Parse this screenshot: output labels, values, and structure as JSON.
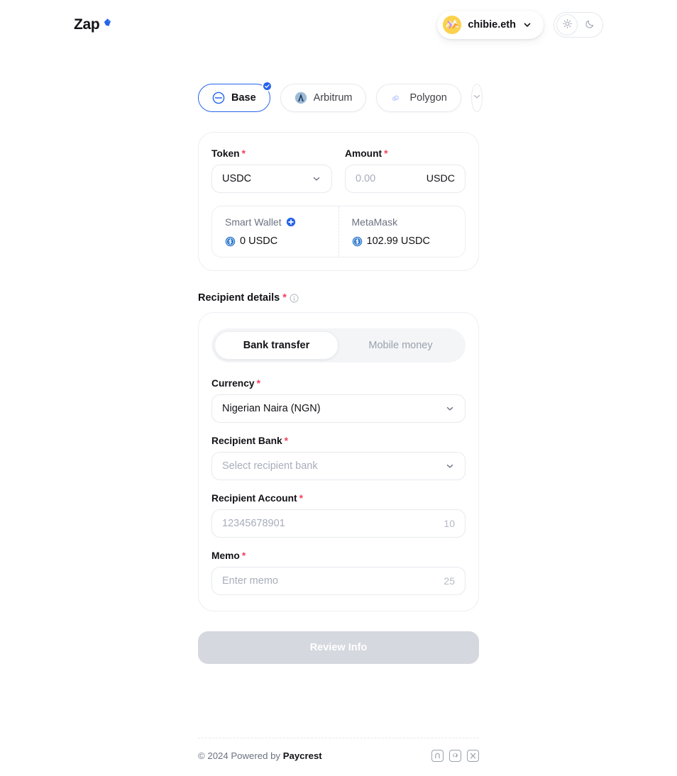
{
  "header": {
    "logo_text": "Zap",
    "logo_icon": "zap-diamond-icon",
    "account": {
      "name": "chibie.eth",
      "avatar_icon": "wallet-avatar",
      "chevron_icon": "chevron-down-icon"
    },
    "theme": {
      "light_icon": "sun-icon",
      "dark_icon": "moon-icon",
      "active": "light"
    }
  },
  "networks": {
    "items": [
      {
        "label": "Base",
        "icon": "base-icon",
        "selected": true,
        "badge_icon": "check-icon"
      },
      {
        "label": "Arbitrum",
        "icon": "arbitrum-icon",
        "selected": false
      },
      {
        "label": "Polygon",
        "icon": "polygon-icon",
        "selected": false
      }
    ],
    "more_icon": "chevron-down-icon"
  },
  "transfer": {
    "token": {
      "label": "Token",
      "required": "*",
      "value": "USDC",
      "chevron_icon": "chevron-down-icon"
    },
    "amount": {
      "label": "Amount",
      "required": "*",
      "placeholder": "0.00",
      "value": "",
      "suffix": "USDC"
    },
    "wallets": [
      {
        "name": "Smart Wallet",
        "balance": "0 USDC",
        "coin_icon": "usdc-icon",
        "action_icon": "plus-circle-icon"
      },
      {
        "name": "MetaMask",
        "balance": "102.99 USDC",
        "coin_icon": "usdc-icon"
      }
    ]
  },
  "recipient": {
    "title": "Recipient details",
    "required": "*",
    "info_icon": "info-icon",
    "tabs": [
      {
        "label": "Bank transfer",
        "active": true
      },
      {
        "label": "Mobile money",
        "active": false
      }
    ],
    "fields": {
      "currency": {
        "label": "Currency",
        "required": "*",
        "value": "Nigerian Naira (NGN)",
        "chevron_icon": "chevron-down-icon"
      },
      "bank": {
        "label": "Recipient Bank",
        "required": "*",
        "value": "",
        "placeholder": "Select recipient bank",
        "chevron_icon": "chevron-down-icon"
      },
      "account": {
        "label": "Recipient Account",
        "required": "*",
        "value": "",
        "placeholder": "12345678901",
        "counter": "10"
      },
      "memo": {
        "label": "Memo",
        "required": "*",
        "value": "",
        "placeholder": "Enter memo",
        "counter": "25"
      }
    }
  },
  "submit": {
    "label": "Review Info",
    "disabled": true
  },
  "footer": {
    "copyright": "© 2024 Powered by ",
    "brand": "Paycrest",
    "icons": [
      {
        "name": "paycrest-icon"
      },
      {
        "name": "github-icon"
      },
      {
        "name": "x-twitter-icon"
      }
    ]
  },
  "colors": {
    "accent": "#2563eb",
    "required": "#f43f5e",
    "text": "#121217",
    "muted": "#6b7280",
    "placeholder": "#a7adba",
    "disabled_bg": "#d5d8de"
  }
}
